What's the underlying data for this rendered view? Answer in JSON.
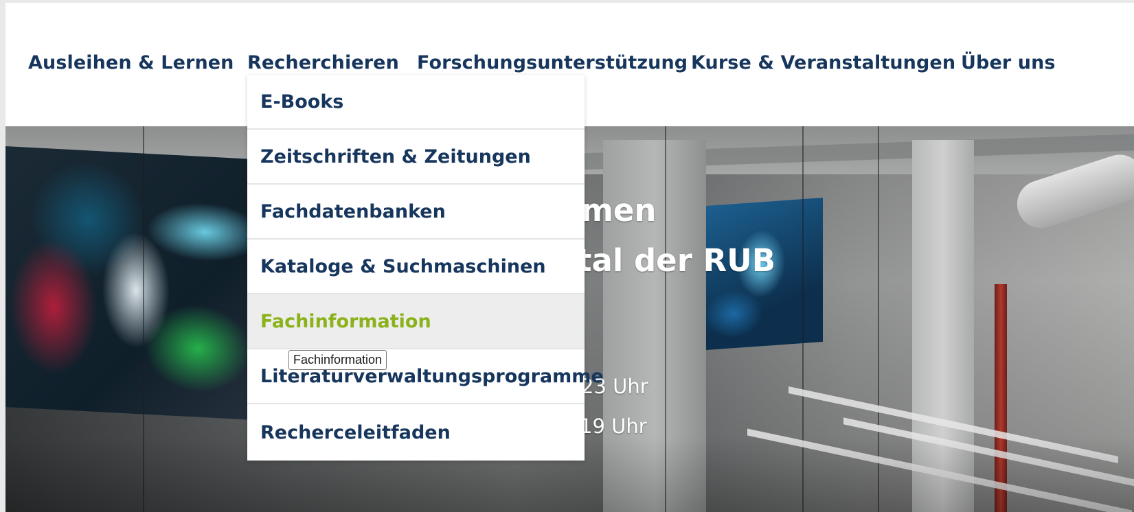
{
  "nav": {
    "items": [
      "Ausleihen & Lernen",
      "Recherchieren",
      "Forschungsunterstützung",
      "Kurse & Veranstaltungen",
      "Über uns"
    ]
  },
  "dropdown": {
    "items": [
      "E-Books",
      "Zeitschriften & Zeitungen",
      "Fachdatenbanken",
      "Kataloge & Suchmaschinen",
      "Fachinformation",
      "Literaturverwaltungsprogramme",
      "Recherceleitfaden"
    ],
    "active_item": "Fachinformation",
    "accent_color": "#8bb21b",
    "text_color": "#17365d"
  },
  "tooltip": {
    "text": "Fachinformation"
  },
  "hero": {
    "title_line1_fragment": "men",
    "title_line2_fragment": "tal der RUB",
    "hours_line1_fragment": "23 Uhr",
    "hours_line2_fragment": "19 Uhr"
  }
}
